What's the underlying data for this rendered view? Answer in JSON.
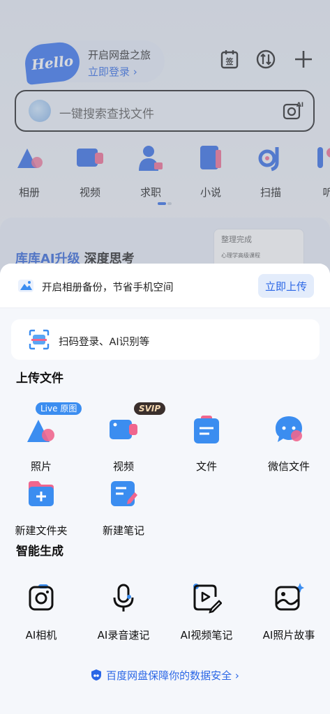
{
  "background": {
    "hello_logo": "Hello",
    "hello_title": "开启网盘之旅",
    "hello_link": "立即登录 ›",
    "top_icons": [
      "sign-in-calendar-icon",
      "transfer-icon",
      "plus-icon"
    ],
    "search_placeholder": "一键搜索查找文件",
    "categories": [
      {
        "label": "相册",
        "icon": "album-icon"
      },
      {
        "label": "视频",
        "icon": "video-icon"
      },
      {
        "label": "求职",
        "icon": "job-icon"
      },
      {
        "label": "小说",
        "icon": "novel-icon"
      },
      {
        "label": "扫描",
        "icon": "scan-icon"
      },
      {
        "label": "听",
        "icon": "listen-icon"
      }
    ],
    "promo_title_blue": "库库AI升级",
    "promo_title_black": "深度思考",
    "promo_card_title": "整理完成",
    "promo_card_row": "心理学高级课程"
  },
  "sheet": {
    "backup_text": "开启相册备份，节省手机空间",
    "backup_button": "立即上传",
    "scan_text": "扫码登录、AI识别等",
    "upload_title": "上传文件",
    "upload_items": [
      {
        "label": "照片",
        "icon": "photo-icon",
        "tag": "Live 原图"
      },
      {
        "label": "视频",
        "icon": "video-icon",
        "tag": "SVIP"
      },
      {
        "label": "文件",
        "icon": "file-icon"
      },
      {
        "label": "微信文件",
        "icon": "wechat-file-icon"
      },
      {
        "label": "新建文件夹",
        "icon": "new-folder-icon"
      },
      {
        "label": "新建笔记",
        "icon": "new-note-icon"
      }
    ],
    "ai_title": "智能生成",
    "ai_items": [
      {
        "label": "AI相机",
        "icon": "ai-camera-icon"
      },
      {
        "label": "AI录音速记",
        "icon": "ai-recorder-icon"
      },
      {
        "label": "AI视频笔记",
        "icon": "ai-video-note-icon"
      },
      {
        "label": "AI照片故事",
        "icon": "ai-photo-story-icon"
      }
    ],
    "footer": "百度网盘保障你的数据安全 ›"
  },
  "colors": {
    "accent": "#2a66e6",
    "pink": "#f0668e",
    "tag_dark": "#3a2f2c"
  }
}
